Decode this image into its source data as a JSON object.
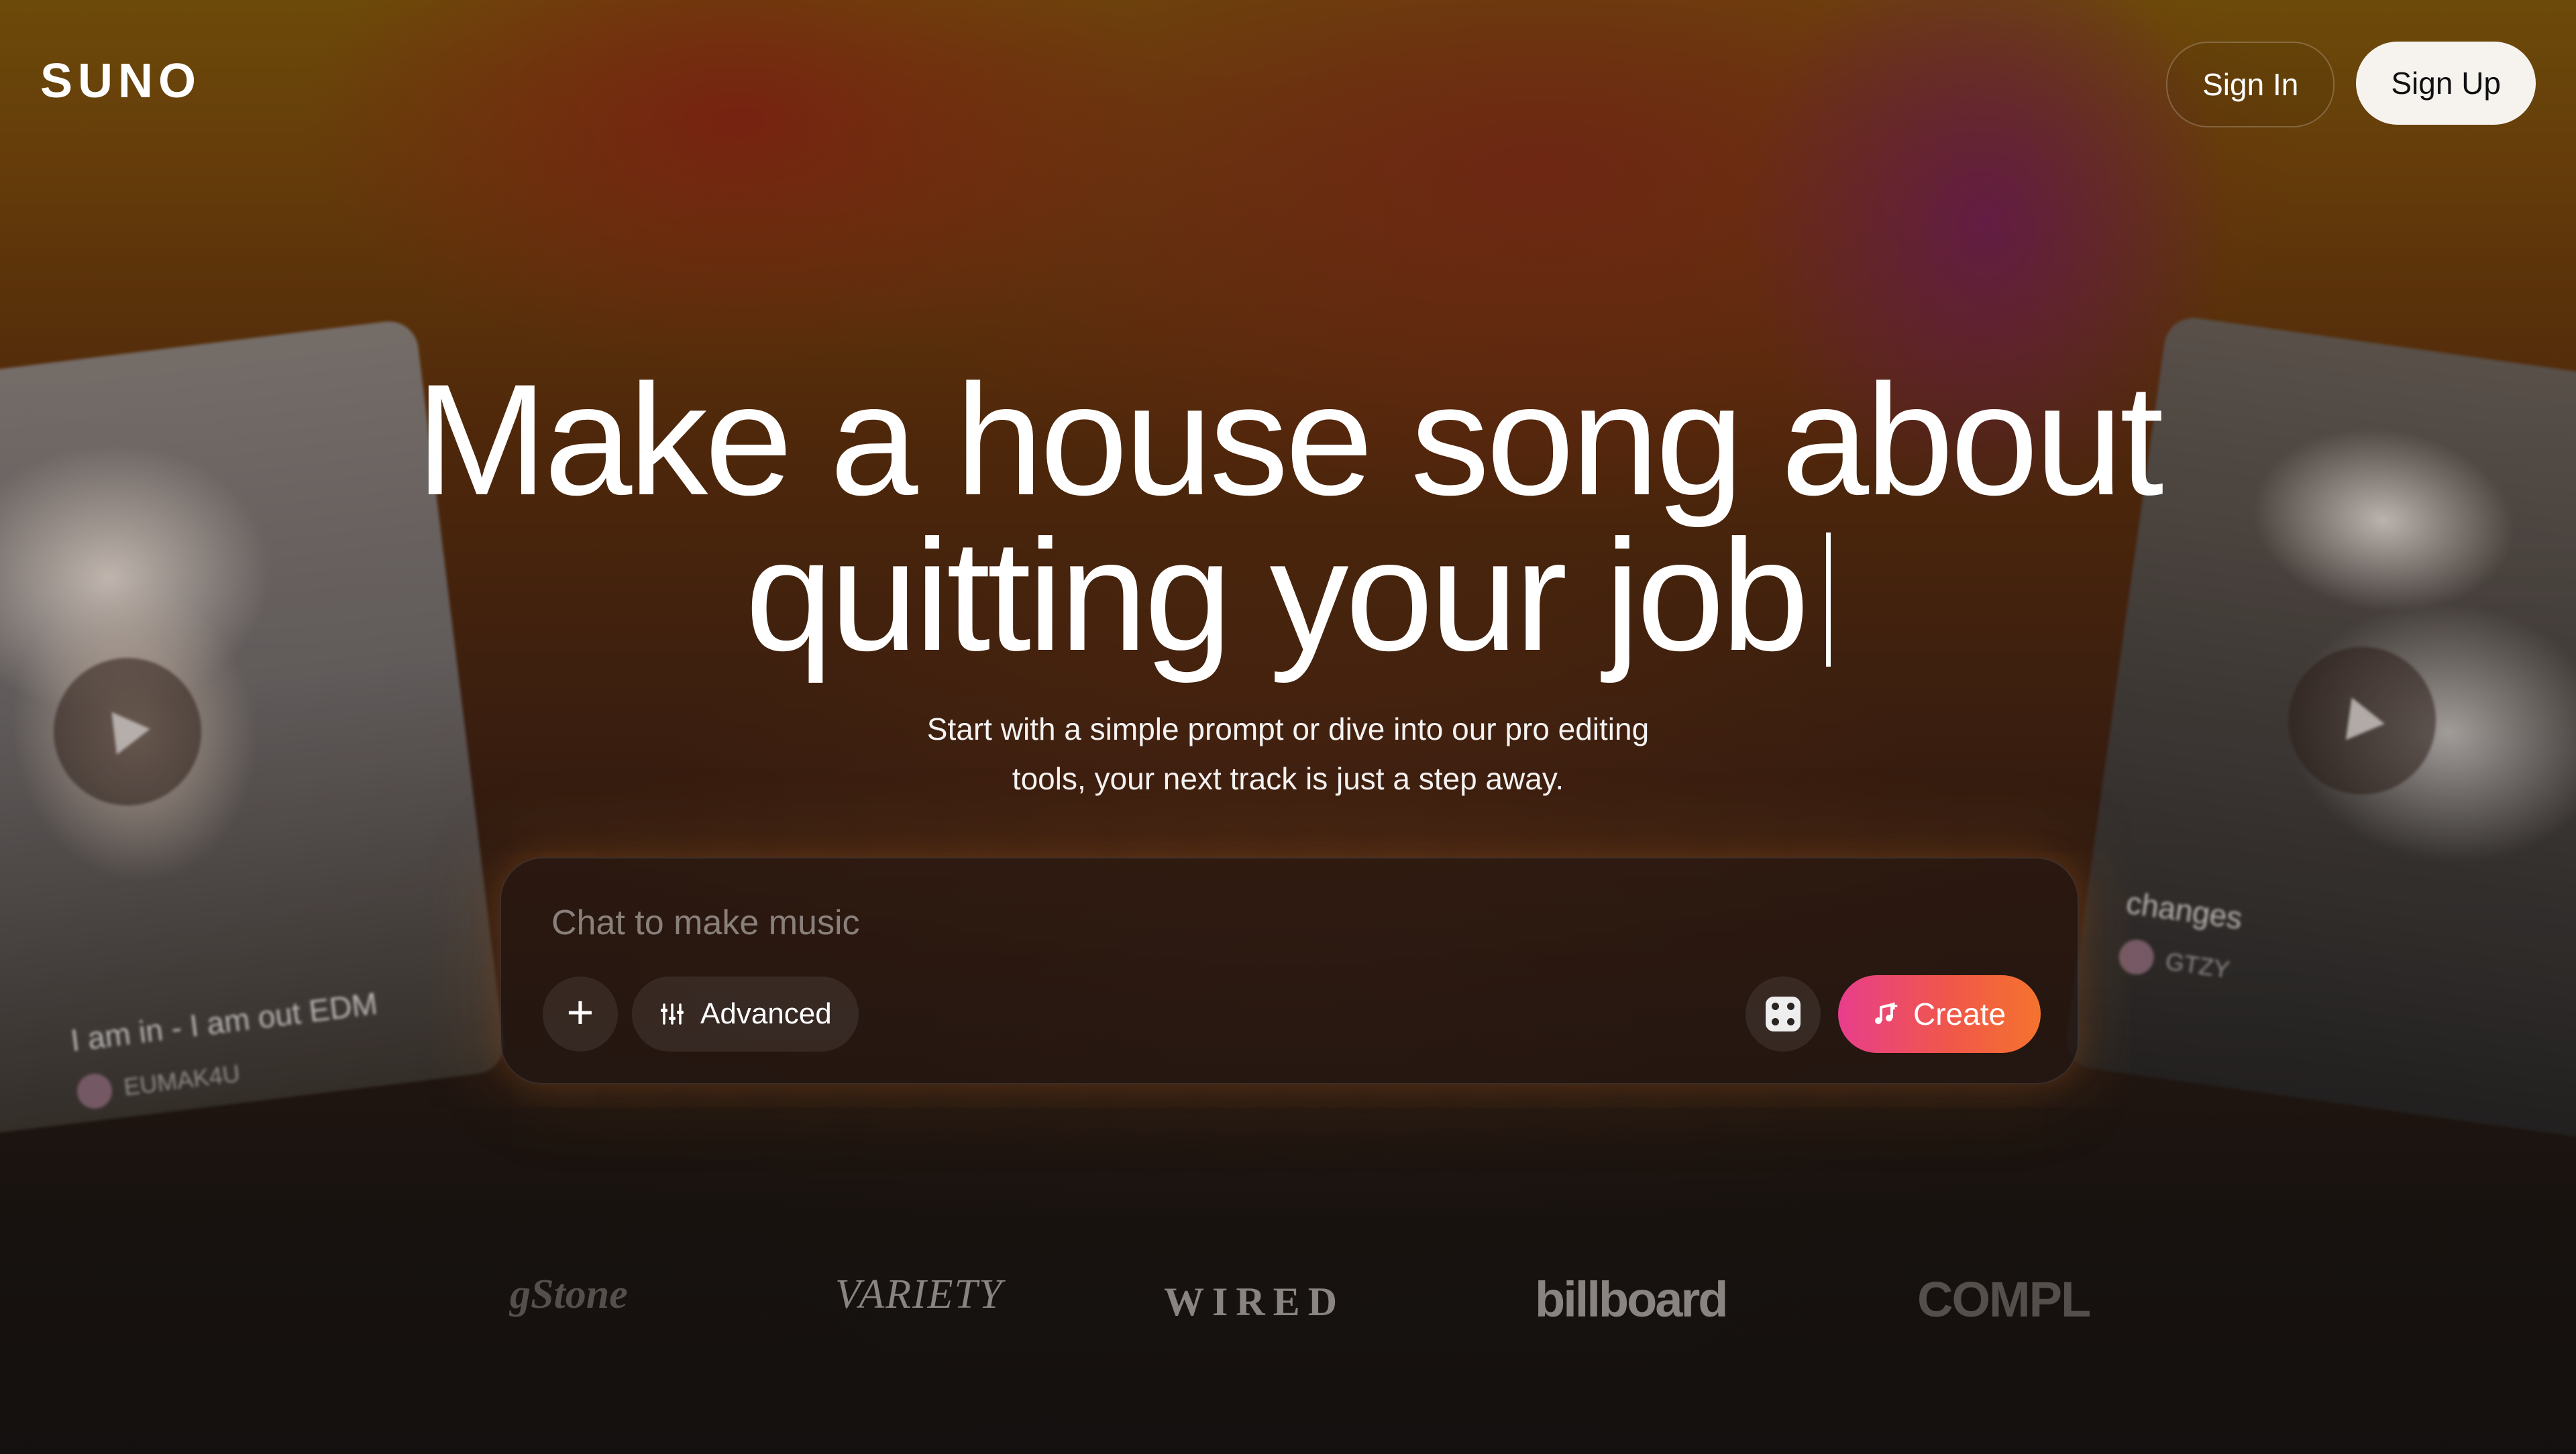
{
  "header": {
    "logo": "SUNO",
    "sign_in": "Sign In",
    "sign_up": "Sign Up"
  },
  "hero": {
    "headline_line1": "Make a house song about",
    "headline_line2": "quitting your job",
    "subtitle_line1": "Start with a simple prompt or dive into our pro editing",
    "subtitle_line2": "tools, your next track is just a step away."
  },
  "prompt": {
    "placeholder": "Chat to make music",
    "advanced_label": "Advanced",
    "create_label": "Create"
  },
  "cards": {
    "left": {
      "title": "I am in - I am out EDM",
      "artist": "EUMAK4U"
    },
    "right": {
      "title": "changes",
      "artist": "GTZY"
    }
  },
  "press": {
    "rolling_stone": "gStone",
    "variety": "VARIETY",
    "wired": "WIRED",
    "billboard": "billboard",
    "complex": "COMPL"
  },
  "colors": {
    "create_gradient_start": "#e83e8c",
    "create_gradient_end": "#f5732d",
    "signup_bg": "#f6f3ef"
  }
}
